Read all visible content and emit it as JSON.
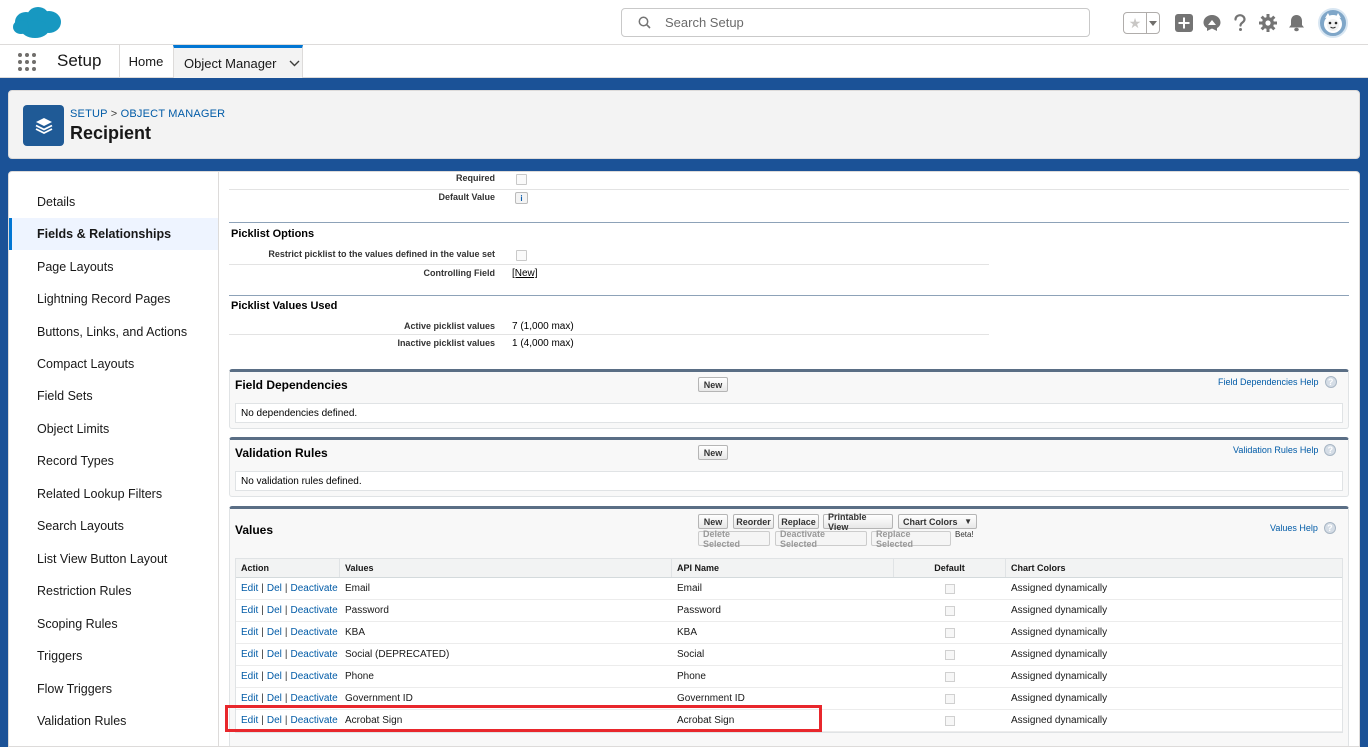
{
  "header": {
    "search_placeholder": "Search Setup",
    "icons": [
      "salesforce-cloud-logo",
      "search-icon",
      "favorites-star-icon",
      "chevron-down-icon",
      "add-icon",
      "trailhead-icon",
      "help-icon",
      "gear-icon",
      "bell-icon",
      "avatar"
    ]
  },
  "nav": {
    "app_name": "Setup",
    "tabs": [
      {
        "label": "Home"
      },
      {
        "label": "Object Manager"
      }
    ]
  },
  "page_header": {
    "breadcrumb_setup": "SETUP",
    "breadcrumb_sep": ">",
    "breadcrumb_om": "OBJECT MANAGER",
    "title": "Recipient"
  },
  "sidebar": {
    "items": [
      {
        "label": "Details"
      },
      {
        "label": "Fields & Relationships"
      },
      {
        "label": "Page Layouts"
      },
      {
        "label": "Lightning Record Pages"
      },
      {
        "label": "Buttons, Links, and Actions"
      },
      {
        "label": "Compact Layouts"
      },
      {
        "label": "Field Sets"
      },
      {
        "label": "Object Limits"
      },
      {
        "label": "Record Types"
      },
      {
        "label": "Related Lookup Filters"
      },
      {
        "label": "Search Layouts"
      },
      {
        "label": "List View Button Layout"
      },
      {
        "label": "Restriction Rules"
      },
      {
        "label": "Scoping Rules"
      },
      {
        "label": "Triggers"
      },
      {
        "label": "Flow Triggers"
      },
      {
        "label": "Validation Rules"
      }
    ],
    "active_index": 1
  },
  "field_props": {
    "required_label": "Required",
    "default_value_label": "Default Value",
    "info_glyph": "i"
  },
  "picklist_options": {
    "title": "Picklist Options",
    "restrict_label": "Restrict picklist to the values defined in the value set",
    "controlling_label": "Controlling Field",
    "controlling_value": "[New]"
  },
  "picklist_values_used": {
    "title": "Picklist Values Used",
    "active_label": "Active picklist values",
    "active_value": "7 (1,000 max)",
    "inactive_label": "Inactive picklist values",
    "inactive_value": "1 (4,000 max)"
  },
  "field_dependencies": {
    "title": "Field Dependencies",
    "new_button": "New",
    "help": "Field Dependencies Help",
    "empty": "No dependencies defined."
  },
  "validation_rules": {
    "title": "Validation Rules",
    "new_button": "New",
    "help": "Validation Rules Help",
    "empty": "No validation rules defined."
  },
  "values": {
    "title": "Values",
    "buttons": {
      "new": "New",
      "reorder": "Reorder",
      "replace": "Replace",
      "printable": "Printable View",
      "chart_colors": "Chart Colors",
      "delete_selected": "Delete Selected",
      "deactivate_selected": "Deactivate Selected",
      "replace_selected": "Replace Selected",
      "beta": "Beta!"
    },
    "help": "Values Help",
    "columns": {
      "action": "Action",
      "values": "Values",
      "api": "API Name",
      "default": "Default",
      "chart": "Chart Colors"
    },
    "action_links": {
      "edit": "Edit",
      "del": "Del",
      "deactivate": "Deactivate",
      "sep": "|"
    },
    "rows": [
      {
        "value": "Email",
        "api": "Email",
        "chart": "Assigned dynamically"
      },
      {
        "value": "Password",
        "api": "Password",
        "chart": "Assigned dynamically"
      },
      {
        "value": "KBA",
        "api": "KBA",
        "chart": "Assigned dynamically"
      },
      {
        "value": "Social (DEPRECATED)",
        "api": "Social",
        "chart": "Assigned dynamically"
      },
      {
        "value": "Phone",
        "api": "Phone",
        "chart": "Assigned dynamically"
      },
      {
        "value": "Government ID",
        "api": "Government ID",
        "chart": "Assigned dynamically"
      },
      {
        "value": "Acrobat Sign",
        "api": "Acrobat Sign",
        "chart": "Assigned dynamically"
      }
    ],
    "highlight_color": "#e8272c"
  },
  "colors": {
    "brand_blue": "#0176d3",
    "backdrop": "#1b5297",
    "link": "#015ba7"
  }
}
